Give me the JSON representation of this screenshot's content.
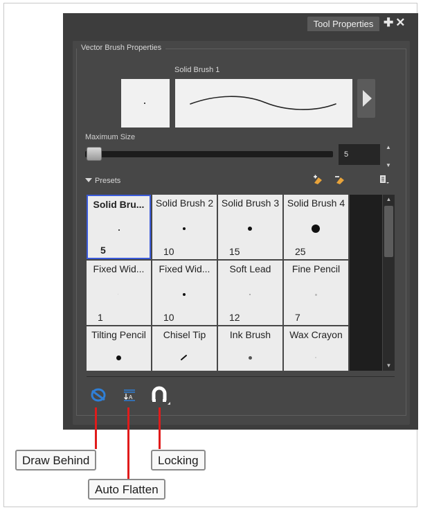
{
  "tab": {
    "label": "Tool Properties"
  },
  "group": {
    "title": "Vector Brush Properties"
  },
  "brush": {
    "name": "Solid Brush 1"
  },
  "max_size": {
    "label": "Maximum Size",
    "value": "5",
    "slider_fraction": 0.02
  },
  "presets": {
    "label": "Presets",
    "items": [
      {
        "name": "Solid Bru...",
        "size": "5"
      },
      {
        "name": "Solid Brush 2",
        "size": "10"
      },
      {
        "name": "Solid Brush 3",
        "size": "15"
      },
      {
        "name": "Solid Brush 4",
        "size": "25"
      },
      {
        "name": "Fixed Wid...",
        "size": "1"
      },
      {
        "name": "Fixed Wid...",
        "size": "10"
      },
      {
        "name": "Soft Lead",
        "size": "12"
      },
      {
        "name": "Fine Pencil",
        "size": "7"
      },
      {
        "name": "Tilting Pencil",
        "size": ""
      },
      {
        "name": "Chisel Tip",
        "size": ""
      },
      {
        "name": "Ink Brush",
        "size": ""
      },
      {
        "name": "Wax Crayon",
        "size": ""
      }
    ]
  },
  "callouts": {
    "draw_behind": "Draw Behind",
    "auto_flatten": "Auto Flatten",
    "locking": "Locking"
  },
  "colors": {
    "selection": "#3b5bdb",
    "callout_line": "#e01b1b",
    "toolbar_icon": "#2f7fd6"
  },
  "icons": [
    "plus-icon",
    "close-icon",
    "play-icon",
    "new-preset-icon",
    "delete-preset-icon",
    "menu-icon",
    "draw-behind-icon",
    "auto-flatten-icon",
    "locking-icon"
  ]
}
